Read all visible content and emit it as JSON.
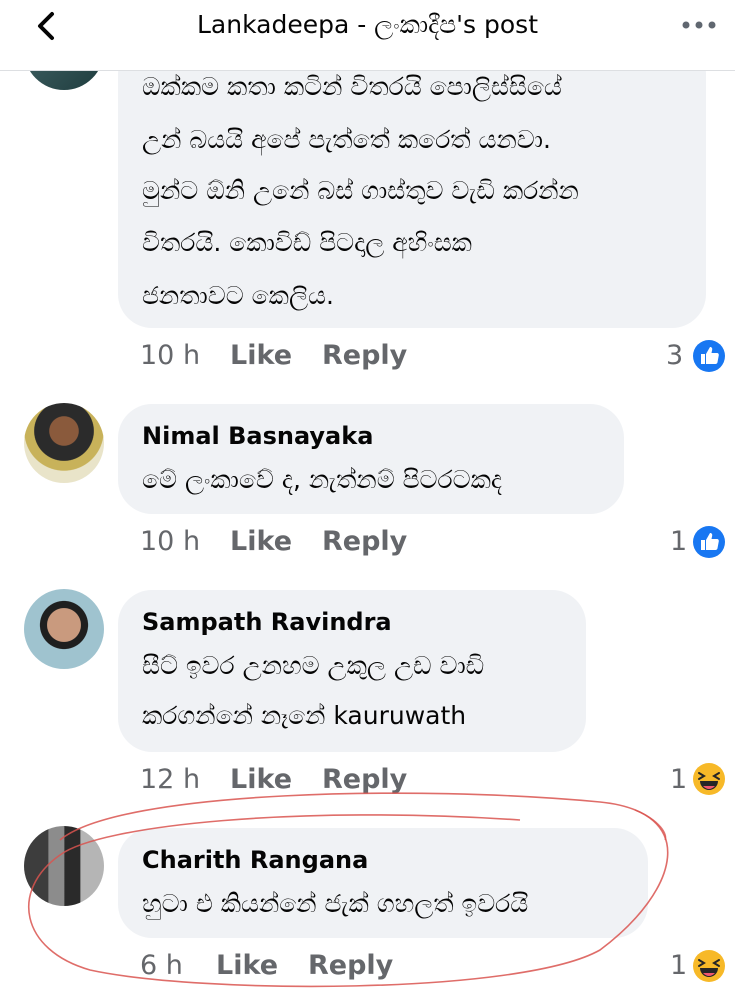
{
  "header": {
    "title": "Lankadeepa - ලංකාදීප's post",
    "back_icon": "chevron-left-icon",
    "more_icon": "more-dots-icon"
  },
  "comments": [
    {
      "author": "",
      "lines": [
        "ඔක්කම කතා කටින් විතරයි පොලිස්සියේ",
        "උන් බයයි අපේ පැත්තේ කරෙත් යනවා.",
        "මුන්ට ඕනි උනේ බස් ගාස්තුව වැඩි කරන්න",
        "විතරයි. කොවිඩ් පිටදාල අහිංසක",
        "ජනතාවට  කෙලිය."
      ],
      "time": "10 h",
      "like_label": "Like",
      "reply_label": "Reply",
      "reaction_count": "3",
      "reaction_icon": "like-reaction-icon"
    },
    {
      "author": "Nimal Basnayaka",
      "lines": [
        "මේ ලංකාවේ ද, නැත්නම් පිටරටකද"
      ],
      "time": "10 h",
      "like_label": "Like",
      "reply_label": "Reply",
      "reaction_count": "1",
      "reaction_icon": "like-reaction-icon"
    },
    {
      "author": "Sampath Ravindra",
      "lines": [
        "සීට් ඉවර උනහම උකුල උඩ වාඩි",
        "කරගන්නේ නෑනේ kauruwath"
      ],
      "time": "12 h",
      "like_label": "Like",
      "reply_label": "Reply",
      "reaction_count": "1",
      "reaction_icon": "haha-reaction-icon"
    },
    {
      "author": "Charith Rangana",
      "lines": [
        "හුටා එ කියන්නේ ජැක් ගහලත් ඉවරයි"
      ],
      "time": "6 h",
      "like_label": "Like",
      "reply_label": "Reply",
      "reaction_count": "1",
      "reaction_icon": "haha-reaction-icon"
    }
  ],
  "colors": {
    "bubble": "#f0f2f5",
    "meta_text": "#65676b",
    "like_blue": "#1877f2",
    "haha_yellow": "#f7b928",
    "annotation_red": "#d9534f"
  }
}
